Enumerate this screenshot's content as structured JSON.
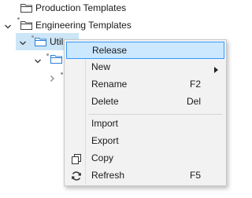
{
  "tree": {
    "nodes": [
      {
        "label": "Production Templates"
      },
      {
        "label": "Engineering Templates"
      },
      {
        "label": "Util"
      }
    ]
  },
  "context_menu": {
    "items": [
      {
        "label": "Release",
        "shortcut": "",
        "icon": "",
        "highlighted": true
      },
      {
        "label": "New",
        "shortcut": "",
        "icon": "",
        "submenu": true
      },
      {
        "label": "Rename",
        "shortcut": "F2",
        "icon": ""
      },
      {
        "label": "Delete",
        "shortcut": "Del",
        "icon": ""
      },
      {
        "label": "Import",
        "shortcut": "",
        "icon": ""
      },
      {
        "label": "Export",
        "shortcut": "",
        "icon": ""
      },
      {
        "label": "Copy",
        "shortcut": "",
        "icon": "copy-icon"
      },
      {
        "label": "Refresh",
        "shortcut": "F5",
        "icon": "refresh-icon"
      }
    ]
  }
}
